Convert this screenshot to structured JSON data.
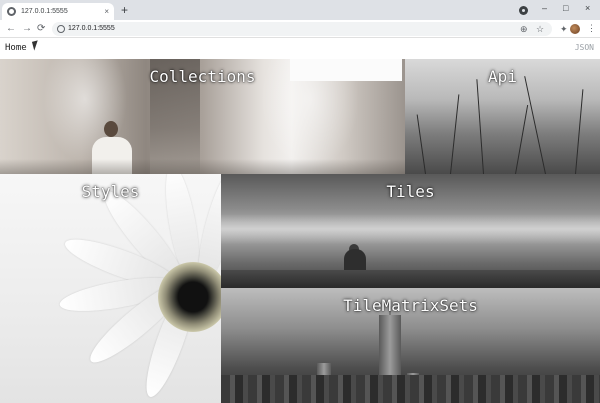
{
  "browser": {
    "tab_title": "127.0.0.1:5555",
    "tab_close": "×",
    "new_tab": "+",
    "window_controls": {
      "minimize": "–",
      "maximize": "□",
      "close": "×"
    },
    "nav": {
      "back": "←",
      "forward": "→",
      "reload": "⟳"
    },
    "url": "127.0.0.1:5555",
    "icons": {
      "zoom": "⊕",
      "bookmark": "☆",
      "extensions": "✦",
      "menu": "⋮"
    }
  },
  "page": {
    "home_label": "Home",
    "json_label": "JSON"
  },
  "tiles": [
    {
      "label": "Collections"
    },
    {
      "label": "Api"
    },
    {
      "label": "Styles"
    },
    {
      "label": "Tiles"
    },
    {
      "label": "TileMatrixSets"
    }
  ]
}
